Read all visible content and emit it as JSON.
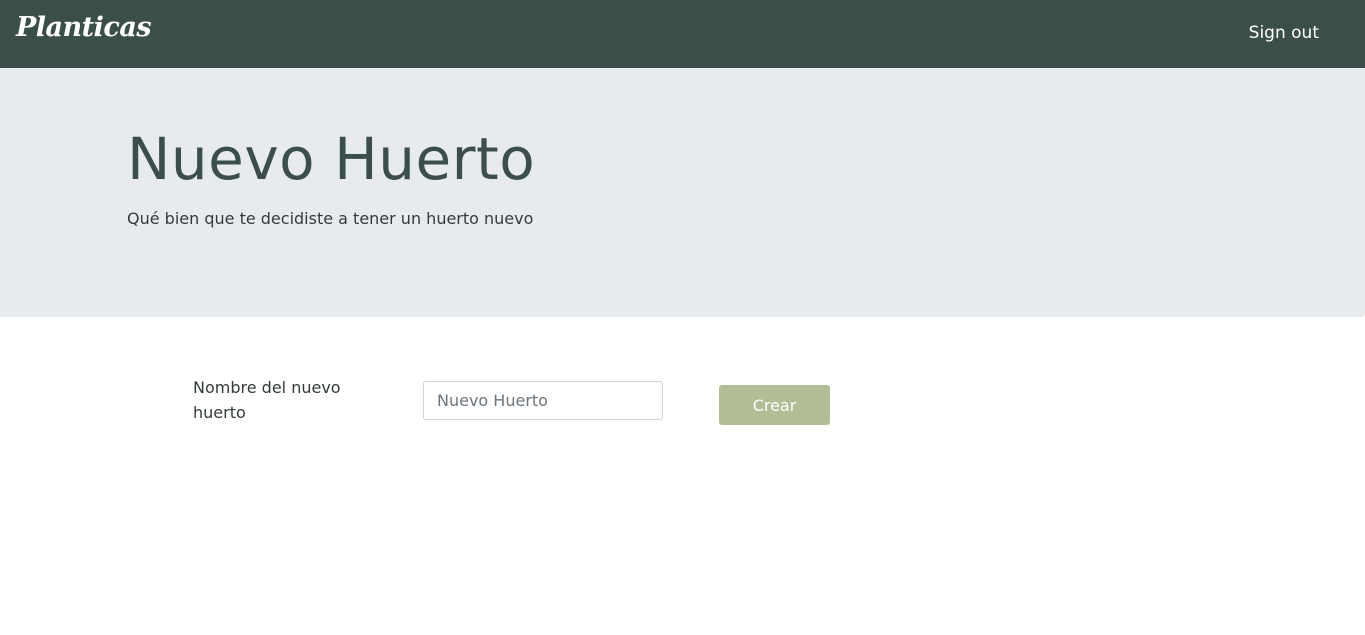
{
  "navbar": {
    "brand": "Planticas",
    "signout_label": "Sign out"
  },
  "header": {
    "title": "Nuevo Huerto",
    "subtitle": "Qué bien que te decidiste a tener un huerto nuevo"
  },
  "form": {
    "name_label": "Nombre del nuevo huerto",
    "name_input": {
      "value": "",
      "placeholder": "Nuevo Huerto"
    },
    "submit_label": "Crear"
  },
  "colors": {
    "navbar_bg": "#3b4e49",
    "jumbotron_bg": "#e8ebee",
    "button_bg": "#b3bd96"
  }
}
